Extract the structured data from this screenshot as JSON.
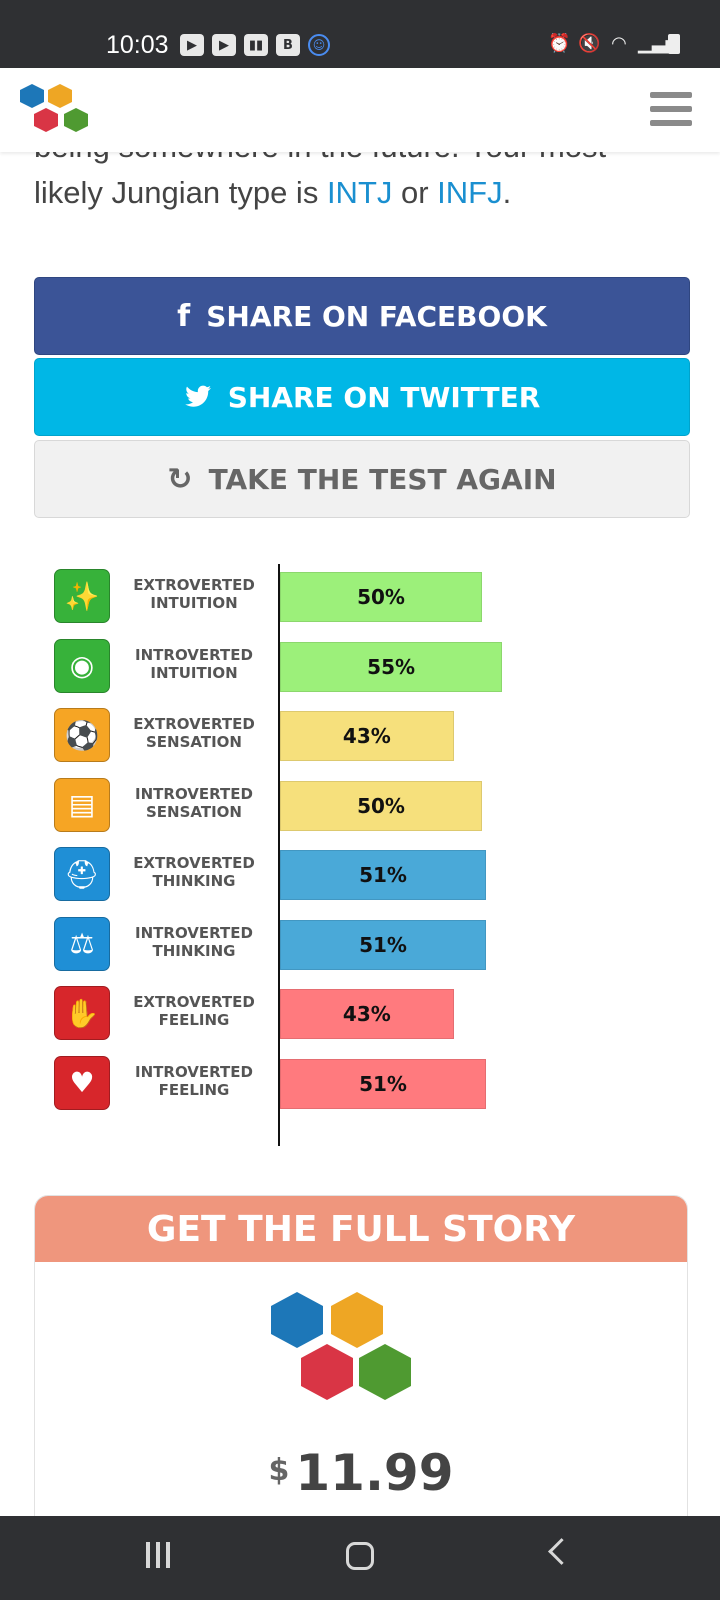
{
  "status_bar": {
    "time": "10:03",
    "notification_icons": [
      "youtube-icon",
      "youtube-icon",
      "twitch-icon",
      "b-app-icon",
      "smiley-icon"
    ],
    "system_icons": [
      "alarm-icon",
      "mute-icon",
      "wifi-icon",
      "signal-icon",
      "battery-icon"
    ]
  },
  "intro": {
    "cut_line": "being somewhere in the future. Your most",
    "prefix": "likely Jungian type is ",
    "type1": "INTJ",
    "or": " or ",
    "type2": "INFJ",
    "suffix": "."
  },
  "buttons": {
    "facebook": "SHARE ON FACEBOOK",
    "twitter": "SHARE ON TWITTER",
    "again": "TAKE THE TEST AGAIN"
  },
  "chart_data": {
    "type": "bar",
    "orientation": "horizontal",
    "xlim": [
      0,
      100
    ],
    "unit": "%",
    "categories": [
      "EXTROVERTED\nINTUITION",
      "INTROVERTED\nINTUITION",
      "EXTROVERTED\nSENSATION",
      "INTROVERTED\nSENSATION",
      "EXTROVERTED\nTHINKING",
      "INTROVERTED\nTHINKING",
      "EXTROVERTED\nFEELING",
      "INTROVERTED\nFEELING"
    ],
    "values": [
      50,
      55,
      43,
      50,
      51,
      51,
      43,
      51
    ],
    "value_labels": [
      "50%",
      "55%",
      "43%",
      "50%",
      "51%",
      "51%",
      "43%",
      "51%"
    ],
    "icons": [
      "magic-wand-icon",
      "crystal-ball-icon",
      "soccer-ball-icon",
      "book-icon",
      "hard-hat-icon",
      "scales-icon",
      "handshake-icon",
      "heart-icon"
    ],
    "colors": [
      "#9cf07a",
      "#9cf07a",
      "#f6e07c",
      "#f6e07c",
      "#4aa9d8",
      "#4aa9d8",
      "#ff7a7e",
      "#ff7a7e"
    ],
    "icon_colors": [
      "#37b23a",
      "#37b23a",
      "#f6a524",
      "#f6a524",
      "#1f8fd6",
      "#1f8fd6",
      "#d7262b",
      "#d7262b"
    ]
  },
  "card": {
    "title": "GET THE FULL STORY",
    "currency": "$",
    "price": "11.99"
  },
  "brand_colors": {
    "facebook": "#3b5497",
    "twitter": "#00b7e6",
    "link": "#1a8fd0",
    "card_header": "#ef967d"
  }
}
